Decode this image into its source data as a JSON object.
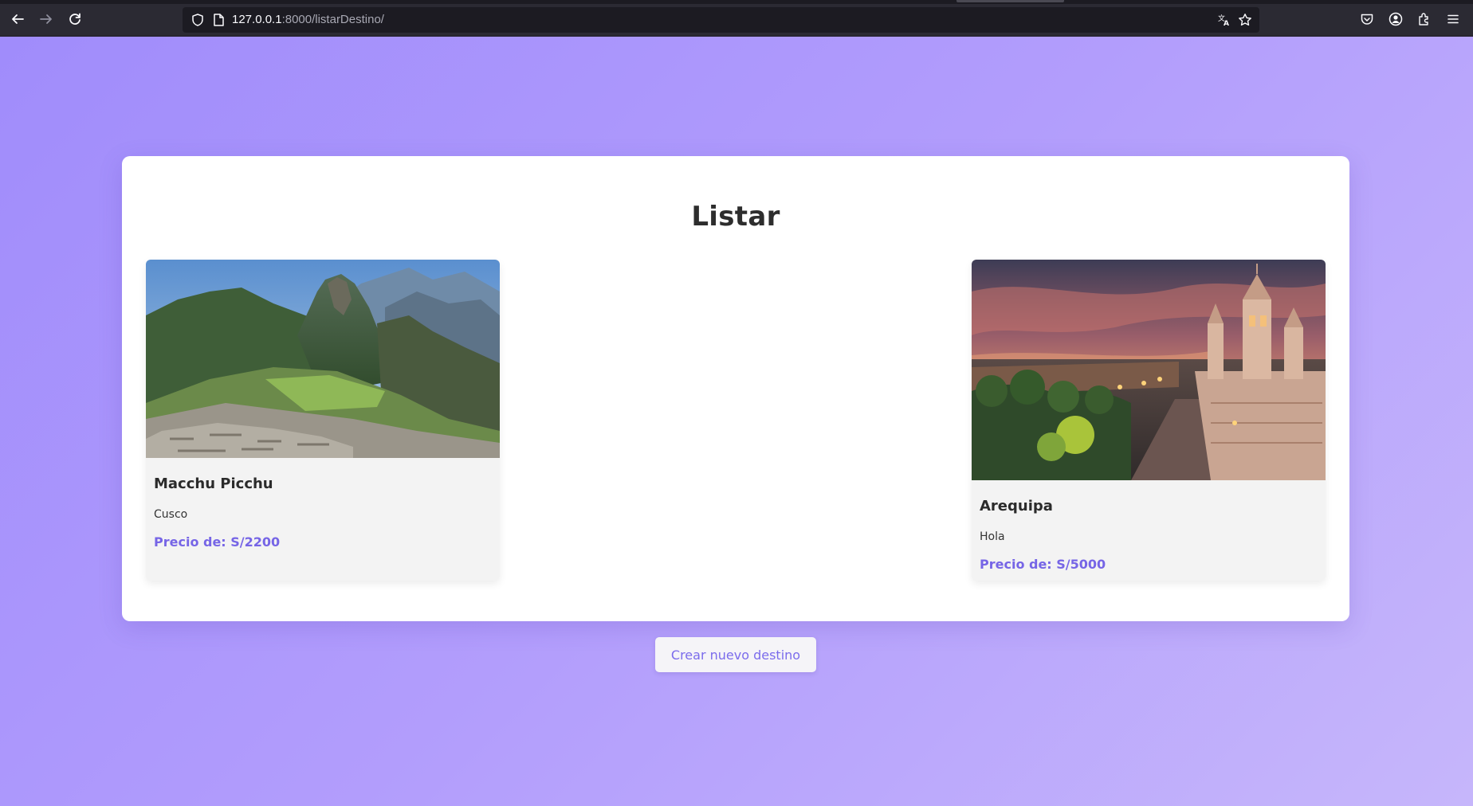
{
  "browser": {
    "url_host": "127.0.0.1",
    "url_rest": ":8000/listarDestino/",
    "icons": [
      "back-arrow-icon",
      "forward-arrow-icon",
      "reload-icon",
      "shield-icon",
      "page-icon",
      "translate-icon",
      "bookmark-star-icon",
      "pocket-icon",
      "account-icon",
      "extensions-icon",
      "menu-icon"
    ]
  },
  "page": {
    "title": "Listar",
    "create_button_label": "Crear nuevo destino"
  },
  "destinations": [
    {
      "name": "Macchu Picchu",
      "region": "Cusco",
      "price": "Precio de: S/2200",
      "image": "mountain-ruins-photo"
    },
    {
      "name": "Arequipa",
      "region": "Hola",
      "price": "Precio de: S/5000",
      "image": "cathedral-plaza-photo"
    }
  ],
  "colors": {
    "accent": "#7665e6",
    "background_start": "#a08cfb",
    "background_end": "#c6b6fb",
    "card_bg": "#f3f3f3"
  }
}
